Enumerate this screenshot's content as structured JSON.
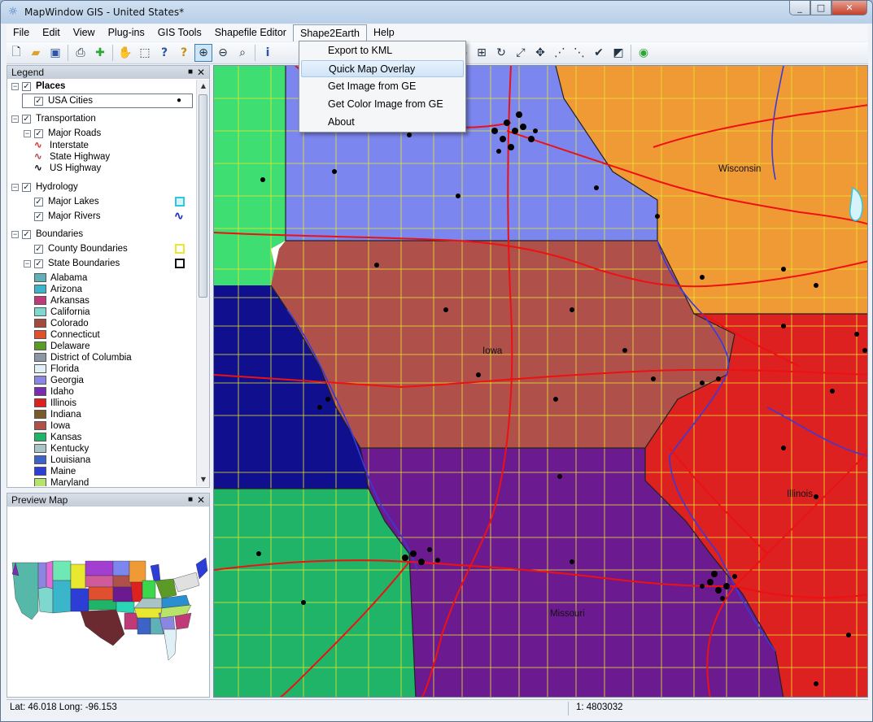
{
  "window": {
    "title": "MapWindow GIS  - United States*",
    "app_icon": "globe-icon",
    "controls": [
      "_",
      "□",
      "✕"
    ]
  },
  "menubar": {
    "items": [
      "File",
      "Edit",
      "View",
      "Plug-ins",
      "GIS Tools",
      "Shapefile Editor",
      "Shape2Earth",
      "Help"
    ]
  },
  "dropdown": {
    "parent": "Shape2Earth",
    "items": [
      "Export to KML",
      "Quick Map Overlay",
      "Get Image from GE",
      "Get Color Image from GE",
      "About"
    ],
    "highlighted": "Quick Map Overlay"
  },
  "legend": {
    "title": "Legend",
    "pin_glyph": "■",
    "close_glyph": "✕",
    "groups": {
      "places": "Places",
      "places_layer": "USA Cities",
      "transportation": "Transportation",
      "roads_layer": "Major Roads",
      "road_types": [
        "Interstate",
        "State Highway",
        "US Highway"
      ],
      "hydrology": "Hydrology",
      "lakes_layer": "Major Lakes",
      "rivers_layer": "Major Rivers",
      "boundaries": "Boundaries",
      "county_layer": "County Boundaries",
      "state_layer": "State Boundaries"
    },
    "states": [
      {
        "name": "Alabama",
        "color": "#5fb0b7"
      },
      {
        "name": "Arizona",
        "color": "#3ab5c9"
      },
      {
        "name": "Arkansas",
        "color": "#c03a78"
      },
      {
        "name": "California",
        "color": "#7fd8cf"
      },
      {
        "name": "Colorado",
        "color": "#a34a3a"
      },
      {
        "name": "Connecticut",
        "color": "#e0502e"
      },
      {
        "name": "Delaware",
        "color": "#5b9a26"
      },
      {
        "name": "District of Columbia",
        "color": "#8d96a4"
      },
      {
        "name": "Florida",
        "color": "#dff0f7"
      },
      {
        "name": "Georgia",
        "color": "#8a86e2"
      },
      {
        "name": "Idaho",
        "color": "#7a2cb0"
      },
      {
        "name": "Illinois",
        "color": "#dd2020"
      },
      {
        "name": "Indiana",
        "color": "#7a5a28"
      },
      {
        "name": "Iowa",
        "color": "#b0504b"
      },
      {
        "name": "Kansas",
        "color": "#20b468"
      },
      {
        "name": "Kentucky",
        "color": "#a8c4c4"
      },
      {
        "name": "Louisiana",
        "color": "#3d63c7"
      },
      {
        "name": "Maine",
        "color": "#2c3ed6"
      },
      {
        "name": "Maryland",
        "color": "#b7e36a"
      }
    ]
  },
  "preview": {
    "title": "Preview Map"
  },
  "map": {
    "labels": [
      "Wisconsin",
      "Iowa",
      "Illinois",
      "Missouri"
    ],
    "colors": {
      "minnesota": "#7b86ee",
      "wisconsin": "#f09a36",
      "iowa": "#b0504b",
      "illinois": "#dd2020",
      "nebraska": "#10108e",
      "south_dakota": "#3fde72",
      "kansas": "#20b468",
      "missouri": "#6b1b8f",
      "county_lines": "#e8e830",
      "roads": "#ee1111"
    }
  },
  "status": {
    "coords": "Lat: 46.018 Long: -96.153",
    "scale": "1: 4803032"
  }
}
